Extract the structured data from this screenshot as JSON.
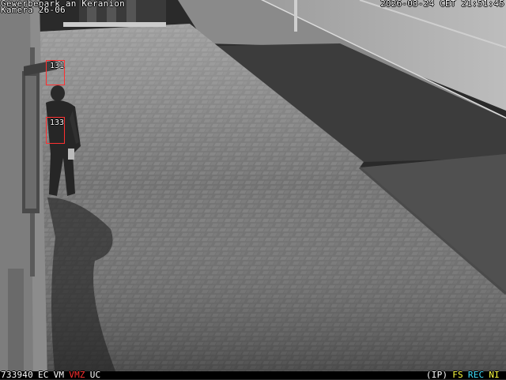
{
  "osd": {
    "site": "Gewerbepark an Keranion",
    "camera": "Kamera 26-06",
    "datetime": "2026-03-24 CET 21:51:45",
    "frame": "733940",
    "bottom_left_tags": [
      {
        "label": "EC",
        "color": "#ffffff"
      },
      {
        "label": "VM",
        "color": "#ffffff"
      },
      {
        "label": "VMZ",
        "color": "#ff3030"
      },
      {
        "label": "UC",
        "color": "#ffffff"
      }
    ],
    "bottom_right_tags": [
      {
        "label": "(IP)",
        "color": "#ffffff"
      },
      {
        "label": "FS",
        "color": "#ffff40"
      },
      {
        "label": "REC",
        "color": "#40e0ff"
      },
      {
        "label": "NI",
        "color": "#ffff40"
      }
    ]
  },
  "detections": [
    {
      "id": "131",
      "label": "131"
    },
    {
      "id": "133",
      "label": "133"
    }
  ],
  "colors": {
    "box": "#ff3030",
    "pavement": "#6e6e6e",
    "asphalt": "#3c3c3c"
  }
}
